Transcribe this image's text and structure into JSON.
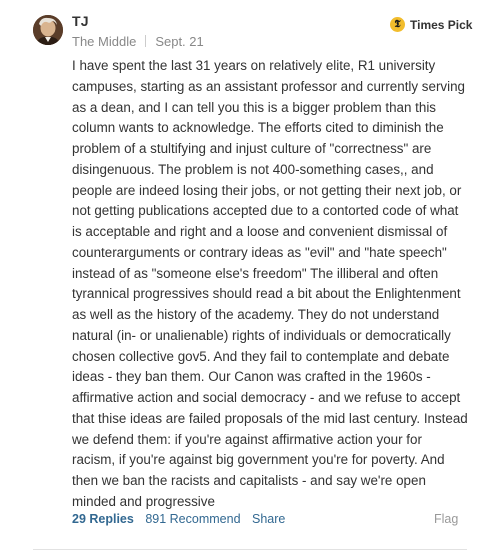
{
  "comment": {
    "author": "TJ",
    "location": "The Middle",
    "date": "Sept. 21",
    "badge_label": "Times Pick",
    "badge_icon": "nyt-t-icon",
    "badge_color": "#f2bd2d",
    "body_lines": [
      "I have spent the last 31 years on relatively elite, R1 university",
      "campuses, starting as an assistant professor and currently serving",
      "as a dean, and I can tell you this is a bigger problem than this",
      "column wants to acknowledge. The efforts cited to diminish the",
      "problem of a stultifying and injust culture of \"correctness\" are",
      "disingenuous. The problem is not 400-something cases,, and",
      "people are indeed losing their jobs, or not getting their next job, or",
      "not getting publications accepted due to a contorted code of what",
      "is acceptable and right and a loose and convenient dismissal of",
      "counterarguments or contrary ideas as \"evil\" and \"hate speech\"",
      "instead of as \"someone else's freedom\" The illiberal and often",
      "tyrannical progressives should read a bit about the Enlightenment",
      "as well as the history of the academy. They do not understand",
      "natural (in- or unalienable) rights of individuals or democratically",
      "chosen collective gov5. And they fail to contemplate and debate",
      "ideas - they ban them. Our Canon was crafted in the 1960s -",
      "affirmative action and social democracy - and we refuse to accept",
      "that thise ideas are failed proposals of the mid last century. Instead",
      "we defend them: if you're against affirmative action your for",
      "racism, if you're against big government you're for poverty. And",
      "then we ban the racists and capitalists - and say we're open",
      "minded and progressive"
    ],
    "actions": {
      "replies": "29 Replies",
      "recommend": "891 Recommend",
      "share": "Share",
      "flag": "Flag"
    },
    "link_color": "#326891"
  }
}
